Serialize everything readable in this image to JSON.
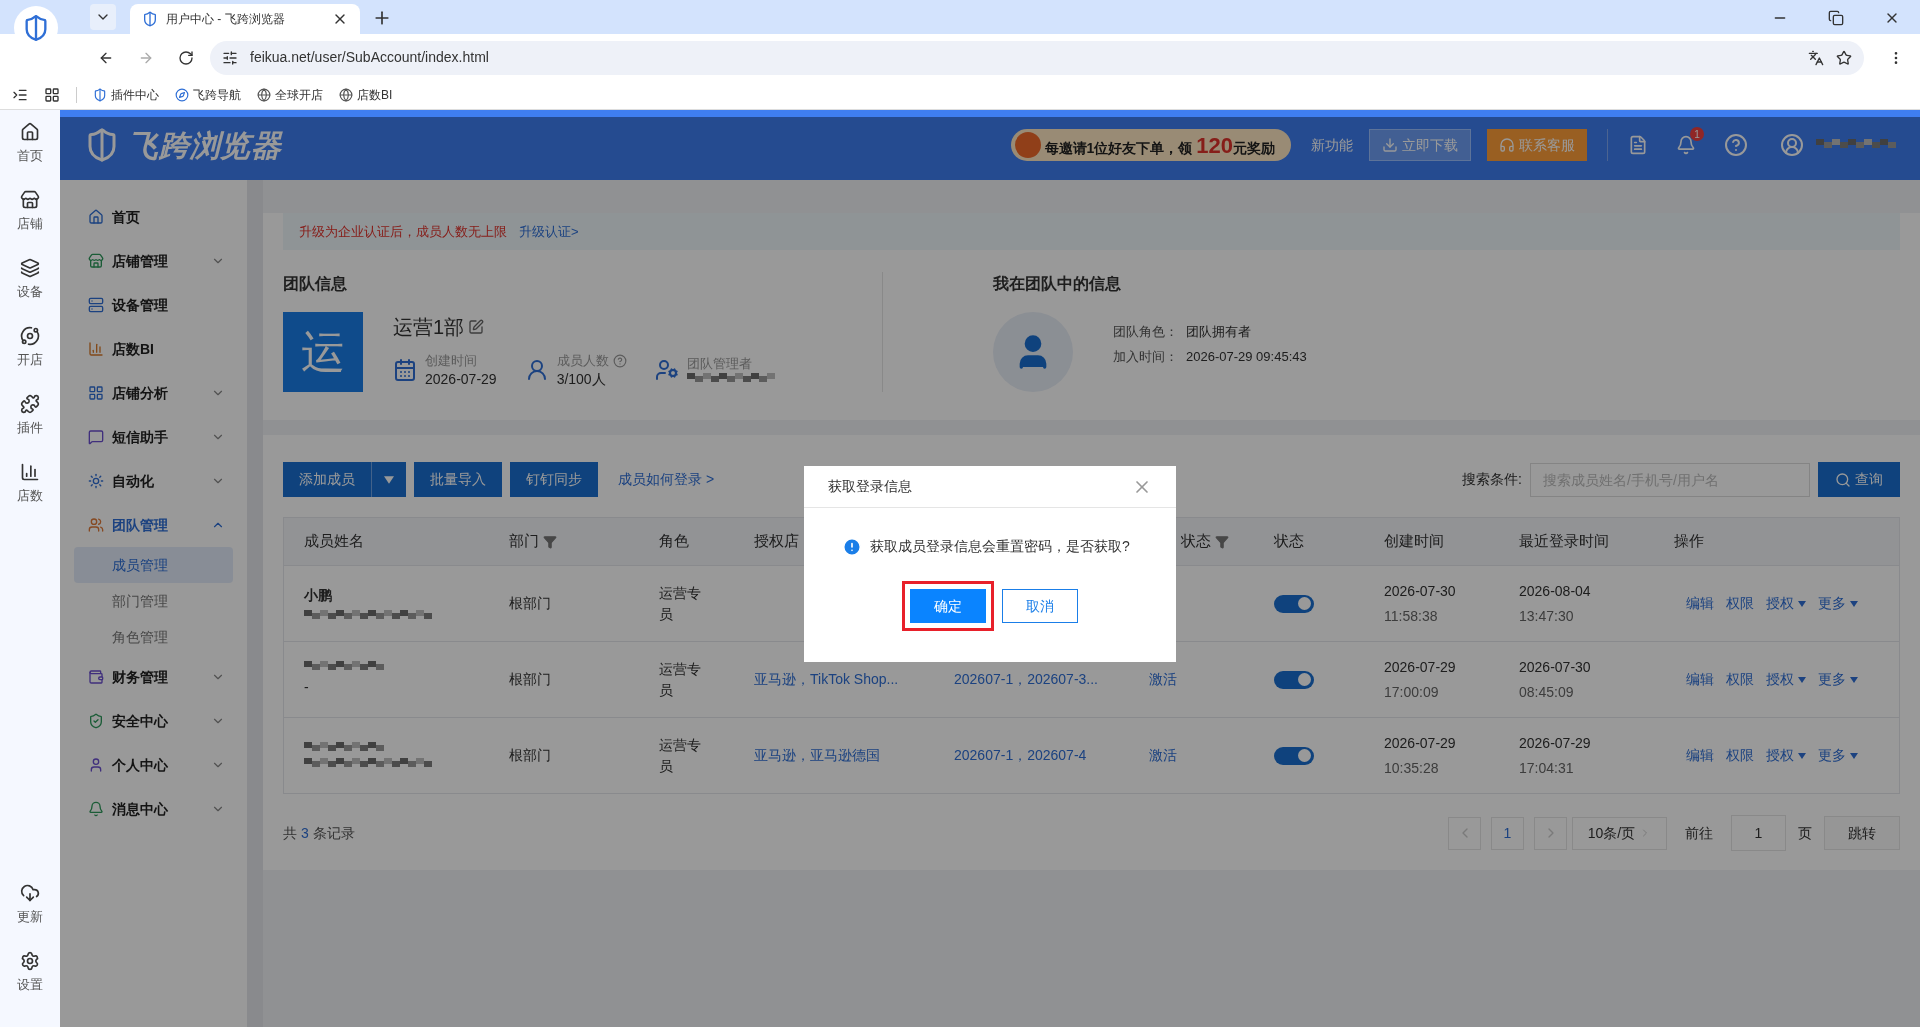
{
  "browser": {
    "tab_title": "用户中心 - 飞跨浏览器",
    "url": "feikua.net/user/SubAccount/index.html",
    "bookmarks": [
      "插件中心",
      "飞跨导航",
      "全球开店",
      "店数BI"
    ]
  },
  "rail": {
    "top": [
      "首页",
      "店铺",
      "设备",
      "开店",
      "插件",
      "店数"
    ],
    "bottom": [
      "更新",
      "设置"
    ]
  },
  "header": {
    "logo": "飞跨浏览器",
    "promo": {
      "before": "每邀请1位好友下单，领",
      "amount": "120",
      "after": "元奖励"
    },
    "new_features": "新功能",
    "download": "立即下载",
    "support": "联系客服",
    "notification_count": "1"
  },
  "sidebar": {
    "items": [
      {
        "label": "首页"
      },
      {
        "label": "店铺管理",
        "expanded": false
      },
      {
        "label": "设备管理"
      },
      {
        "label": "店数BI"
      },
      {
        "label": "店铺分析",
        "expanded": false
      },
      {
        "label": "短信助手",
        "expanded": false
      },
      {
        "label": "自动化",
        "expanded": false
      },
      {
        "label": "团队管理",
        "expanded": true,
        "children": [
          {
            "label": "成员管理",
            "selected": true
          },
          {
            "label": "部门管理",
            "selected": false
          },
          {
            "label": "角色管理",
            "selected": false
          }
        ]
      },
      {
        "label": "财务管理",
        "expanded": false
      },
      {
        "label": "安全中心",
        "expanded": false
      },
      {
        "label": "个人中心",
        "expanded": false
      },
      {
        "label": "消息中心",
        "expanded": false
      }
    ]
  },
  "notice": {
    "text": "升级为企业认证后，成员人数无上限",
    "link": "升级认证>"
  },
  "team_info": {
    "title": "团队信息",
    "avatar_char": "运",
    "name": "运营1部",
    "stats": [
      {
        "label": "创建时间",
        "value": "2026-07-29",
        "help": false
      },
      {
        "label": "成员人数",
        "value": "3/100人",
        "help": true
      },
      {
        "label": "团队管理者",
        "help": false
      }
    ]
  },
  "my_info": {
    "title": "我在团队中的信息",
    "rows": [
      {
        "label": "团队角色：",
        "value": "团队拥有者"
      },
      {
        "label": "加入时间：",
        "value": "2026-07-29 09:45:43"
      }
    ]
  },
  "toolbar": {
    "add": "添加成员",
    "import": "批量导入",
    "sync": "钉钉同步",
    "help_link": "成员如何登录 >",
    "search_label": "搜索条件:",
    "search": {
      "placeholder": "搜索成员姓名/手机号/用户名"
    },
    "search_button": "查询"
  },
  "table": {
    "columns": [
      {
        "label": "成员姓名",
        "filter": false
      },
      {
        "label": "部门",
        "filter": true
      },
      {
        "label": "角色",
        "filter": false
      },
      {
        "label": "授权店"
      },
      {},
      {
        "label": "状态",
        "filter": true
      },
      {
        "label": "状态",
        "filter": false
      },
      {
        "label": "创建时间",
        "filter": false
      },
      {
        "label": "最近登录时间",
        "filter": false
      },
      {
        "label": "操作",
        "filter": false
      }
    ],
    "rows": [
      {
        "name": "小鹏",
        "dept": "根部门",
        "role": "运营专员",
        "on": true,
        "created_date": "2026-07-30",
        "created_time": "11:58:38",
        "login_date": "2026-08-04",
        "login_time": "13:47:30",
        "actions": [
          {
            "label": "编辑",
            "menu": false
          },
          {
            "label": "权限",
            "menu": false
          },
          {
            "label": "授权",
            "menu": true
          },
          {
            "label": "更多",
            "menu": true
          }
        ]
      },
      {
        "phone": "-",
        "dept": "根部门",
        "role": "运营专员",
        "stores": "亚马逊，TikTok Shop...",
        "accounts": "202607-1，202607-3...",
        "status": "激活",
        "on": true,
        "created_date": "2026-07-29",
        "created_time": "17:00:09",
        "login_date": "2026-07-30",
        "login_time": "08:45:09",
        "actions": [
          {
            "label": "编辑",
            "menu": false
          },
          {
            "label": "权限",
            "menu": false
          },
          {
            "label": "授权",
            "menu": true
          },
          {
            "label": "更多",
            "menu": true
          }
        ]
      },
      {
        "dept": "根部门",
        "role": "运营专员",
        "stores": "亚马逊，亚马逊德国",
        "accounts": "202607-1，202607-4",
        "status": "激活",
        "on": true,
        "created_date": "2026-07-29",
        "created_time": "10:35:28",
        "login_date": "2026-07-29",
        "login_time": "17:04:31",
        "actions": [
          {
            "label": "编辑",
            "menu": false
          },
          {
            "label": "权限",
            "menu": false
          },
          {
            "label": "授权",
            "menu": true
          },
          {
            "label": "更多",
            "menu": true
          }
        ]
      }
    ]
  },
  "pagination": {
    "total_before": "共",
    "total": "3",
    "total_after": "条记录",
    "pages": [
      {
        "label": "1",
        "selected": true
      }
    ],
    "page_size": "10条/页",
    "goto": "前往",
    "goto_value": "1",
    "page_unit": "页",
    "jump": "跳转"
  },
  "dialog": {
    "title": "获取登录信息",
    "message": "获取成员登录信息会重置密码，是否获取?",
    "confirm": "确定",
    "cancel": "取消",
    "confirm_highlighted": true
  }
}
